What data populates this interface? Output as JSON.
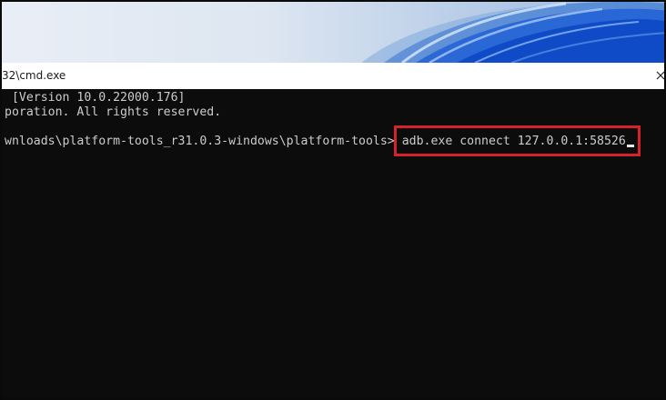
{
  "window": {
    "title": "32\\cmd.exe"
  },
  "console": {
    "lines": [
      " [Version 10.0.22000.176]",
      "poration. All rights reserved."
    ],
    "prompt": "wnloads\\platform-tools_r31.0.3-windows\\platform-tools>",
    "command": " adb.exe connect 127.0.0.1:58526"
  },
  "colors": {
    "console_bg": "#0c0c0c",
    "console_text": "#cccccc",
    "highlight": "#d6222b"
  }
}
